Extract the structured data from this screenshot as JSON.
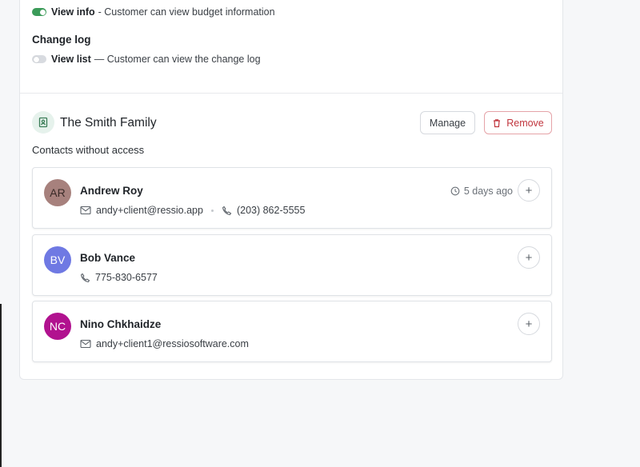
{
  "permissions": {
    "view_info": {
      "name": "View info",
      "desc": "- Customer can view budget information",
      "enabled": true
    },
    "change_log": {
      "heading": "Change log",
      "view_list": {
        "name": "View list",
        "desc": "— Customer can view the change log",
        "enabled": false
      }
    }
  },
  "group": {
    "title": "The Smith Family",
    "manage_label": "Manage",
    "remove_label": "Remove",
    "contacts_heading": "Contacts without access"
  },
  "contacts": [
    {
      "initials": "AR",
      "name": "Andrew Roy",
      "email": "andy+client@ressio.app",
      "phone": "(203) 862-5555",
      "last_seen": "5 days ago",
      "avatar_color": "#a7817d"
    },
    {
      "initials": "BV",
      "name": "Bob Vance",
      "phone": "775-830-6577",
      "avatar_color": "#6f79e3"
    },
    {
      "initials": "NC",
      "name": "Nino Chkhaidze",
      "email": "andy+client1@ressiosoftware.com",
      "avatar_color": "#b1128f"
    }
  ],
  "icons": {
    "group": "contact-book-icon",
    "remove": "trash-icon",
    "email": "mail-icon",
    "phone": "phone-icon",
    "time": "clock-icon",
    "add": "plus-icon"
  },
  "colors": {
    "toggle_on": "#3b9b59",
    "remove_red": "#c0353d",
    "group_icon_bg": "#e6f2ec"
  }
}
